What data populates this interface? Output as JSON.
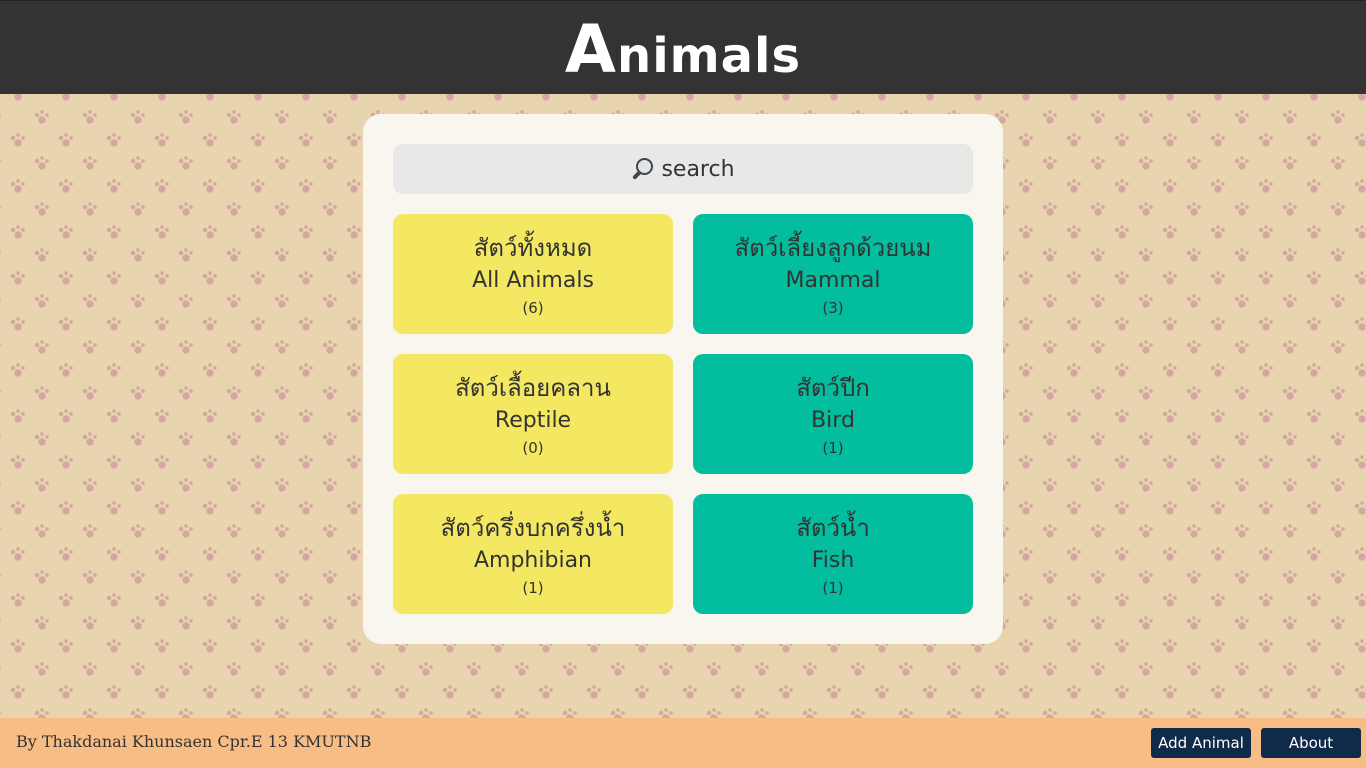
{
  "header": {
    "logo_text_first": "A",
    "logo_text_rest": "nimals"
  },
  "search": {
    "placeholder": "search",
    "icon": "magnifier-icon"
  },
  "categories": [
    {
      "th": "สัตว์ทั้งหมด",
      "en": "All Animals",
      "count": "(6)",
      "color": "#f4e862"
    },
    {
      "th": "สัตว์เลี้ยงลูกด้วยนม",
      "en": "Mammal",
      "count": "(3)",
      "color": "#02be9f"
    },
    {
      "th": "สัตว์เลื้อยคลาน",
      "en": "Reptile",
      "count": "(0)",
      "color": "#f4e862"
    },
    {
      "th": "สัตว์ปีก",
      "en": "Bird",
      "count": "(1)",
      "color": "#02be9f"
    },
    {
      "th": "สัตว์ครึ่งบกครึ่งน้ำ",
      "en": "Amphibian",
      "count": "(1)",
      "color": "#f4e862"
    },
    {
      "th": "สัตว์น้ำ",
      "en": "Fish",
      "count": "(1)",
      "color": "#02be9f"
    }
  ],
  "footer": {
    "credit": "By Thakdanai Khunsaen Cpr.E 13 KMUTNB",
    "add_label": "Add Animal",
    "about_label": "About"
  },
  "colors": {
    "header_bg": "#333333",
    "footer_bg": "#f7bd84",
    "button_bg": "#102a4a",
    "yellow": "#f4e862",
    "teal": "#02be9f"
  }
}
